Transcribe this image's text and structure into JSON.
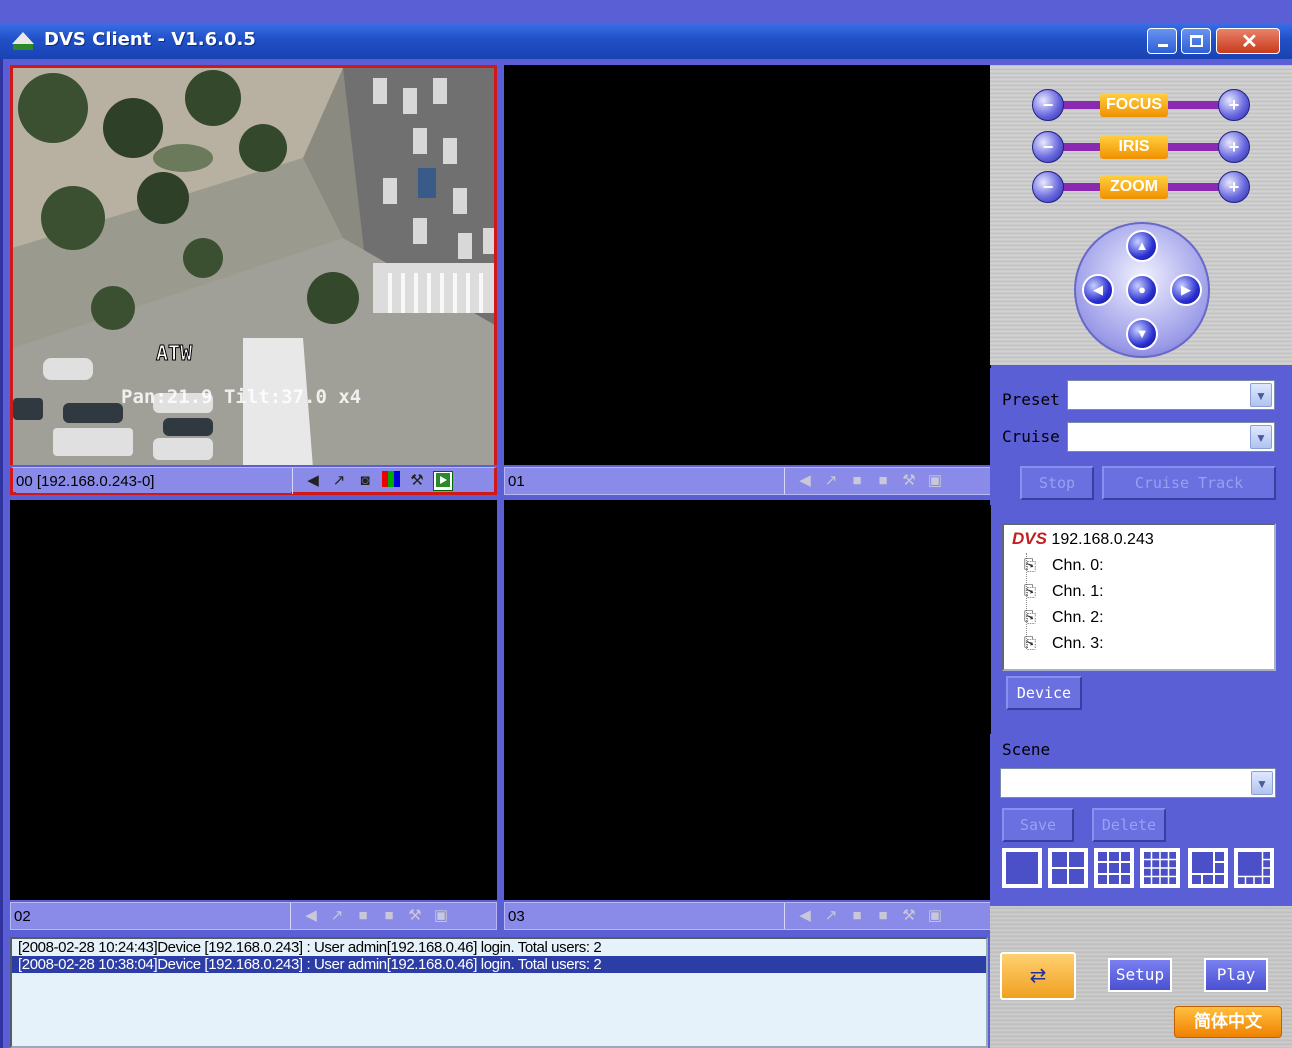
{
  "window": {
    "title": "DVS Client - V1.6.0.5",
    "close_glyph": "✕"
  },
  "cells": [
    {
      "label": "00 [192.168.0.243-0]",
      "active": true,
      "overlay_text": "ATW",
      "overlay_text2": "Pan:21.9  Tilt:37.0 x4"
    },
    {
      "label": "01",
      "active": false
    },
    {
      "label": "02",
      "active": false
    },
    {
      "label": "03",
      "active": false
    }
  ],
  "cell_tools": [
    "speaker-icon",
    "microphone-icon",
    "camera-icon",
    "color-icon",
    "tool-icon",
    "record-icon"
  ],
  "log": [
    "[2008-02-28 10:24:43]Device [192.168.0.243] : User admin[192.168.0.46] login. Total users: 2",
    "[2008-02-28 10:38:04]Device [192.168.0.243] : User admin[192.168.0.46] login. Total users: 2"
  ],
  "ptz": {
    "focus": "FOCUS",
    "iris": "IRIS",
    "zoom": "ZOOM"
  },
  "preset_panel": {
    "preset_label": "Preset",
    "cruise_label": "Cruise",
    "preset_value": "",
    "cruise_value": "",
    "stop_label": "Stop",
    "cruise_track_label": "Cruise Track"
  },
  "tree": {
    "root": "192.168.0.243",
    "root_icon_text": "DVS",
    "channels": [
      "Chn. 0:",
      "Chn. 1:",
      "Chn. 2:",
      "Chn. 3:"
    ]
  },
  "device_button": "Device",
  "scene": {
    "label": "Scene",
    "value": "",
    "save_label": "Save",
    "delete_label": "Delete"
  },
  "bottom": {
    "setup_label": "Setup",
    "play_label": "Play",
    "language_label": "简体中文"
  },
  "colors": {
    "panel": "#5b5fd6",
    "active_border": "#d01818",
    "accent_orange": "#f09000"
  }
}
